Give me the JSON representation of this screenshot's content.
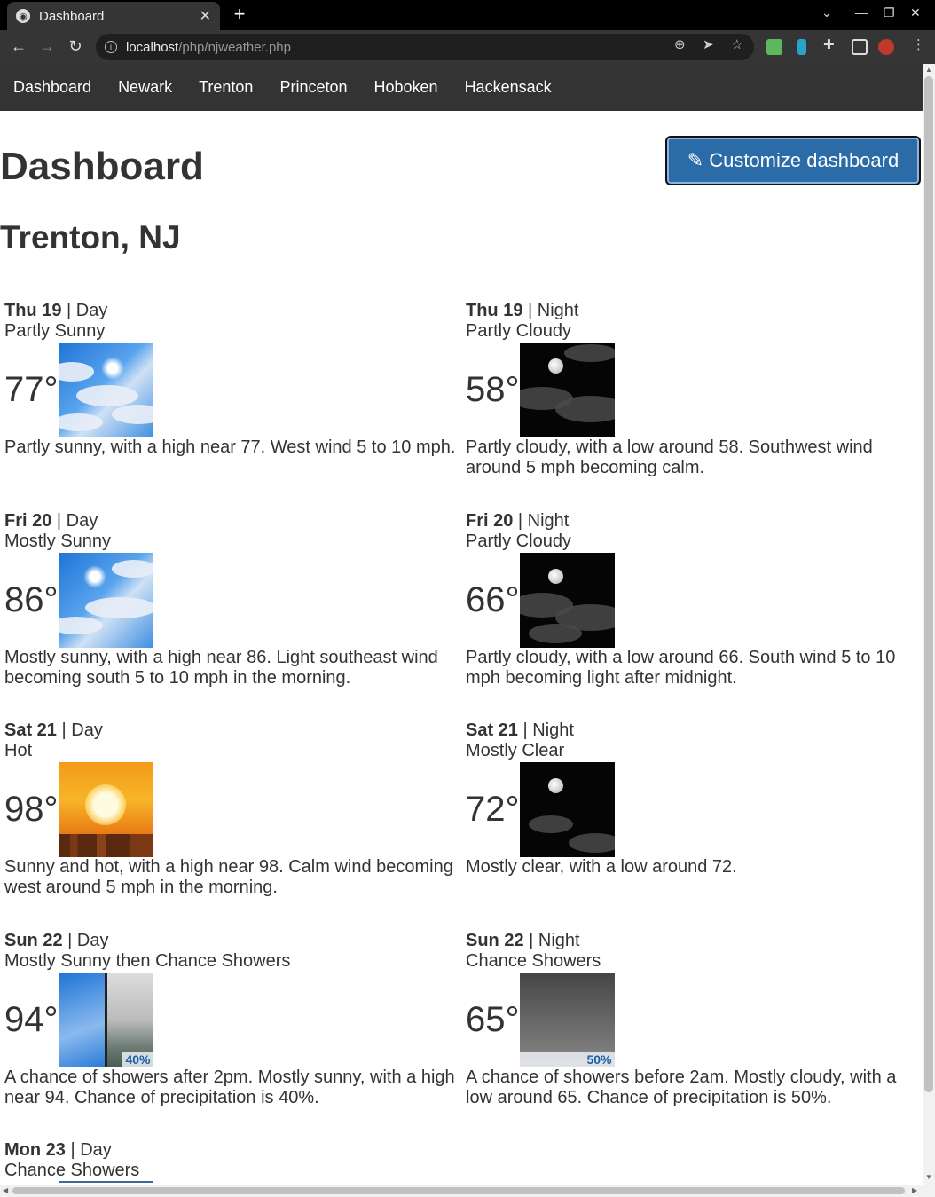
{
  "browser": {
    "tab_title": "Dashboard",
    "tab_close": "✕",
    "new_tab": "+",
    "url_host": "localhost",
    "url_path": "/php/njweather.php"
  },
  "nav": {
    "items": [
      "Dashboard",
      "Newark",
      "Trenton",
      "Princeton",
      "Hoboken",
      "Hackensack"
    ]
  },
  "page": {
    "title": "Dashboard",
    "customize_label": "Customize dashboard",
    "city": "Trenton, NJ"
  },
  "forecast": [
    {
      "day": "Thu 19",
      "part": "Night",
      "short": "Partly Cloudy",
      "temp": "58°",
      "detail": "Partly cloudy, with a low around 58. Southwest wind around 5 mph becoming calm.",
      "icon": "night-partly-cloudy-icon"
    },
    {
      "day": "Thu 19",
      "part": "Day",
      "short": "Partly Sunny",
      "temp": "77°",
      "detail": "Partly sunny, with a high near 77. West wind 5 to 10 mph.",
      "icon": "partly-sunny-icon"
    },
    {
      "day": "Fri 20",
      "part": "Day",
      "short": "Mostly Sunny",
      "temp": "86°",
      "detail": "Mostly sunny, with a high near 86. Light southeast wind becoming south 5 to 10 mph in the morning.",
      "icon": "mostly-sunny-icon"
    },
    {
      "day": "Fri 20",
      "part": "Night",
      "short": "Partly Cloudy",
      "temp": "66°",
      "detail": "Partly cloudy, with a low around 66. South wind 5 to 10 mph becoming light after midnight.",
      "icon": "night-partly-cloudy-icon"
    },
    {
      "day": "Sat 21",
      "part": "Day",
      "short": "Hot",
      "temp": "98°",
      "detail": "Sunny and hot, with a high near 98. Calm wind becoming west around 5 mph in the morning.",
      "icon": "hot-sun-icon"
    },
    {
      "day": "Sat 21",
      "part": "Night",
      "short": "Mostly Clear",
      "temp": "72°",
      "detail": "Mostly clear, with a low around 72.",
      "icon": "night-mostly-clear-icon"
    },
    {
      "day": "Sun 22",
      "part": "Day",
      "short": "Mostly Sunny then Chance Showers",
      "temp": "94°",
      "detail": "A chance of showers after 2pm. Mostly sunny, with a high near 94. Chance of precipitation is 40%.",
      "icon": "sunny-then-showers-icon",
      "pop": "40%"
    },
    {
      "day": "Sun 22",
      "part": "Night",
      "short": "Chance Showers",
      "temp": "65°",
      "detail": "A chance of showers before 2am. Mostly cloudy, with a low around 65. Chance of precipitation is 50%.",
      "icon": "night-showers-icon",
      "pop": "50%"
    },
    {
      "day": "Mon 23",
      "part": "Day",
      "short": "Chance Showers",
      "temp": "",
      "detail": "",
      "icon": "showers-icon"
    }
  ],
  "separator": " | "
}
